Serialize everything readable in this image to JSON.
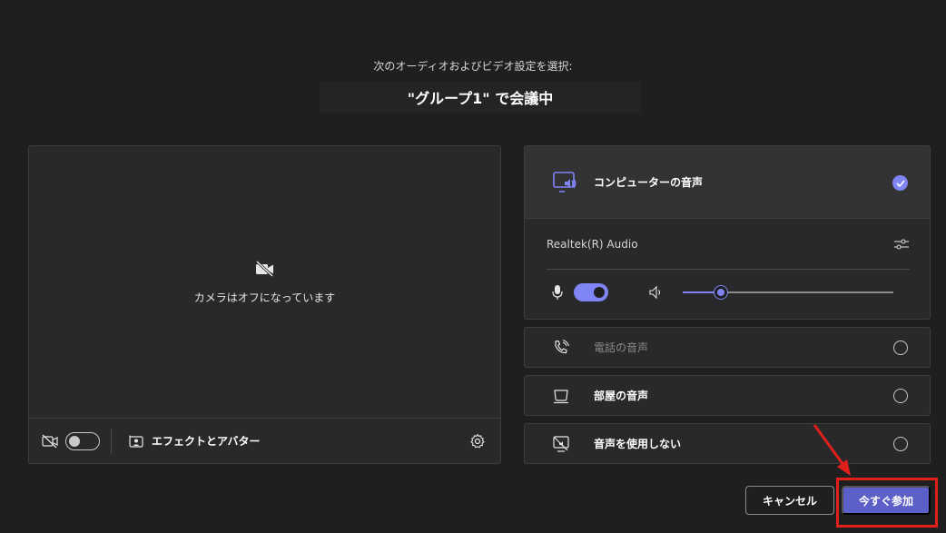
{
  "header": {
    "prompt": "次のオーディオおよびビデオ設定を選択:",
    "meeting_title": "\"グループ1\" で会議中"
  },
  "video": {
    "camera_off_text": "カメラはオフになっています",
    "camera_toggle": "off",
    "effects_label": "エフェクトとアバター"
  },
  "audio": {
    "selected_option": "コンピューターの音声",
    "device_name": "Realtek(R) Audio",
    "mic_toggle": "on",
    "speaker_volume": 0.18,
    "options": [
      {
        "label": "電話の音声",
        "state": "disabled"
      },
      {
        "label": "部屋の音声",
        "state": "unselected"
      },
      {
        "label": "音声を使用しない",
        "state": "unselected"
      }
    ]
  },
  "buttons": {
    "cancel": "キャンセル",
    "join_now": "今すぐ参加"
  },
  "annotation": {
    "color": "#e0201b",
    "target": "join_now"
  },
  "colors": {
    "accent": "#7f85f5",
    "join_button": "#5b5fc7",
    "background": "#1f1f1f"
  }
}
